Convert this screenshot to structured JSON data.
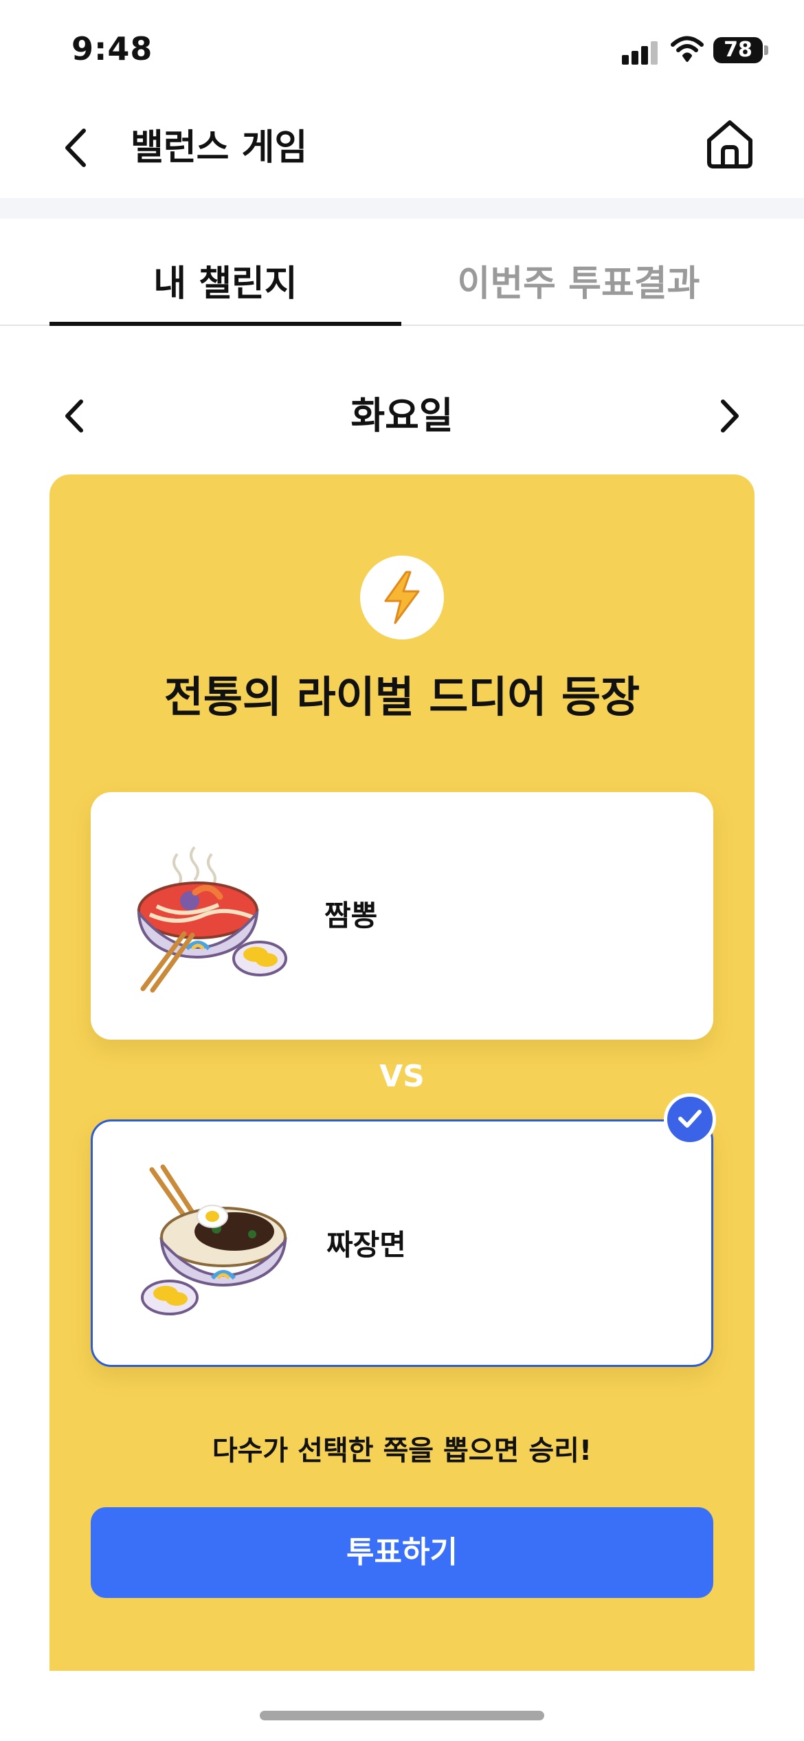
{
  "status_bar": {
    "time": "9:48",
    "battery": "78"
  },
  "header": {
    "title": "밸런스 게임",
    "back_icon": "chevron-left-icon",
    "home_icon": "home-icon"
  },
  "tabs": [
    {
      "label": "내 챌린지",
      "active": true
    },
    {
      "label": "이번주 투표결과",
      "active": false
    }
  ],
  "day_nav": {
    "label": "화요일"
  },
  "game": {
    "icon": "lightning-bolt-icon",
    "question": "전통의 라이벌 드디어 등장",
    "options": [
      {
        "label": "짬뽕",
        "selected": false
      },
      {
        "label": "짜장면",
        "selected": true
      }
    ],
    "vs": "VS",
    "hint": "다수가 선택한 쪽을 뽑으면 승리!",
    "vote_label": "투표하기"
  },
  "colors": {
    "card": "#f5d155",
    "primary": "#3a6ff7",
    "selected_border": "#2d5bd6"
  }
}
